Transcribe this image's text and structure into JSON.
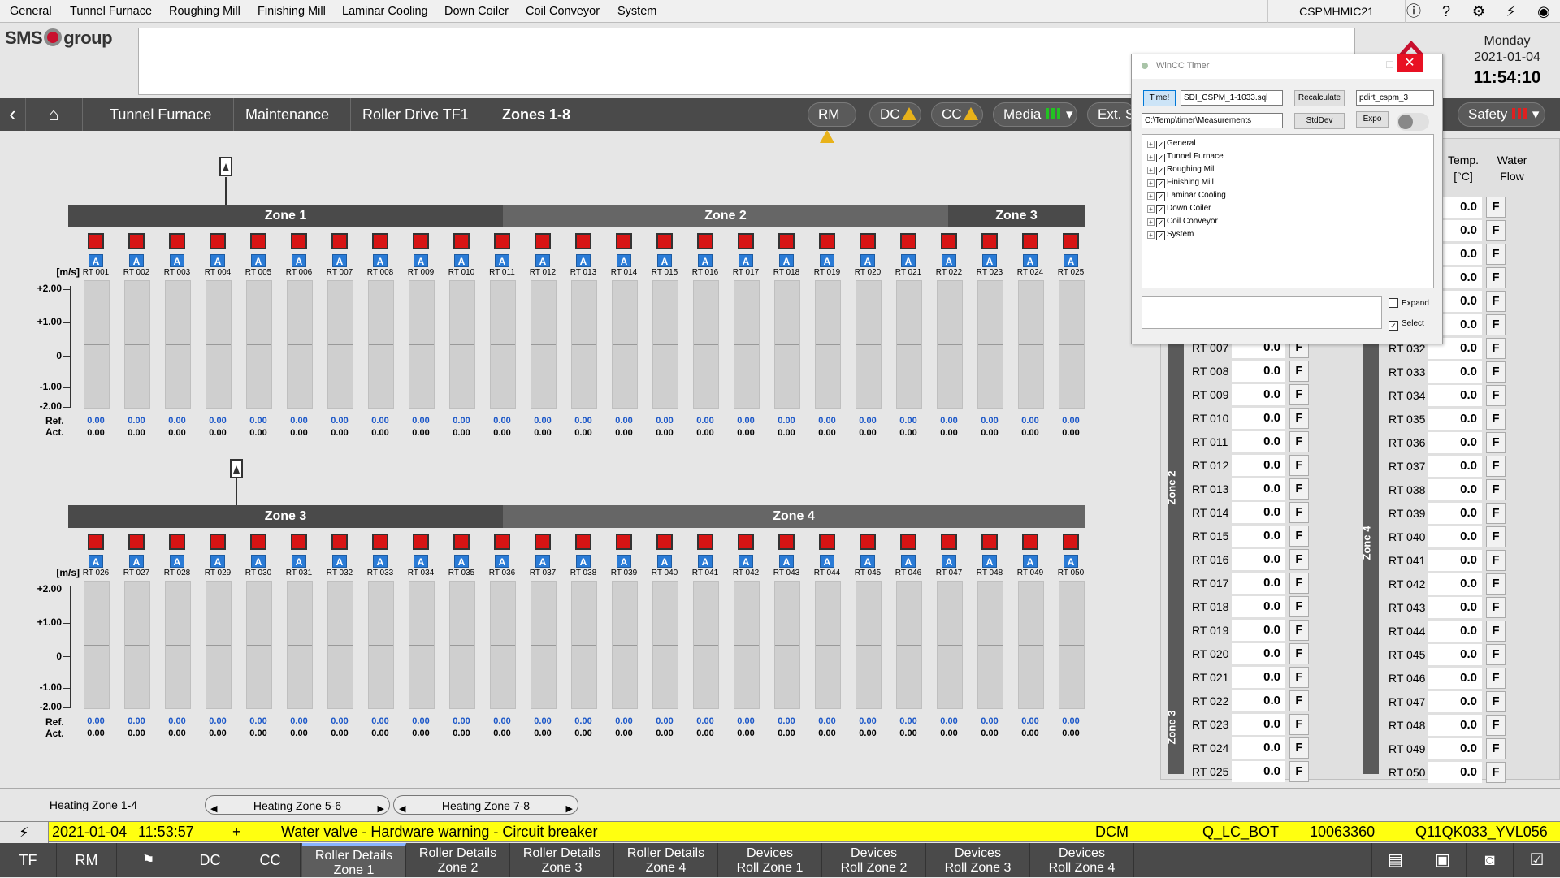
{
  "top_menu": {
    "items": [
      "General",
      "Tunnel Furnace",
      "Roughing Mill",
      "Finishing Mill",
      "Laminar Cooling",
      "Down Coiler",
      "Coil Conveyor",
      "System"
    ],
    "hostname": "CSPMHMIC21",
    "icons": [
      "info-icon",
      "help-icon",
      "settings-icon",
      "power-icon",
      "view-icon"
    ]
  },
  "brand": {
    "logo_text": "SMS",
    "logo_text2": "group"
  },
  "datetime": {
    "day": "Monday",
    "date": "2021-01-04",
    "time": "11:54:10"
  },
  "nav": {
    "crumbs": [
      "Tunnel Furnace",
      "Maintenance",
      "Roller Drive TF1",
      "Zones 1-8"
    ],
    "pills": [
      "RM",
      "DC",
      "CC",
      "Media",
      "Ext. S"
    ],
    "safety": "Safety"
  },
  "panel_top": {
    "zones": [
      "Zone 1",
      "Zone 2",
      "Zone 3"
    ],
    "unit": "[m/s]",
    "yticks": [
      "+2.00",
      "+1.00",
      "0",
      "-1.00",
      "-2.00"
    ],
    "ref_label": "Ref.",
    "act_label": "Act.",
    "rollers": [
      "RT 001",
      "RT 002",
      "RT 003",
      "RT 004",
      "RT 005",
      "RT 006",
      "RT 007",
      "RT 008",
      "RT 009",
      "RT 010",
      "RT 011",
      "RT 012",
      "RT 013",
      "RT 014",
      "RT 015",
      "RT 016",
      "RT 017",
      "RT 018",
      "RT 019",
      "RT 020",
      "RT 021",
      "RT 022",
      "RT 023",
      "RT 024",
      "RT 025"
    ],
    "ref": [
      "0.00",
      "0.00",
      "0.00",
      "0.00",
      "0.00",
      "0.00",
      "0.00",
      "0.00",
      "0.00",
      "0.00",
      "0.00",
      "0.00",
      "0.00",
      "0.00",
      "0.00",
      "0.00",
      "0.00",
      "0.00",
      "0.00",
      "0.00",
      "0.00",
      "0.00",
      "0.00",
      "0.00",
      "0.00"
    ],
    "act": [
      "0.00",
      "0.00",
      "0.00",
      "0.00",
      "0.00",
      "0.00",
      "0.00",
      "0.00",
      "0.00",
      "0.00",
      "0.00",
      "0.00",
      "0.00",
      "0.00",
      "0.00",
      "0.00",
      "0.00",
      "0.00",
      "0.00",
      "0.00",
      "0.00",
      "0.00",
      "0.00",
      "0.00",
      "0.00"
    ]
  },
  "panel_bottom": {
    "zones": [
      "Zone 3",
      "Zone 4"
    ],
    "unit": "[m/s]",
    "yticks": [
      "+2.00",
      "+1.00",
      "0",
      "-1.00",
      "-2.00"
    ],
    "ref_label": "Ref.",
    "act_label": "Act.",
    "rollers": [
      "RT 026",
      "RT 027",
      "RT 028",
      "RT 029",
      "RT 030",
      "RT 031",
      "RT 032",
      "RT 033",
      "RT 034",
      "RT 035",
      "RT 036",
      "RT 037",
      "RT 038",
      "RT 039",
      "RT 040",
      "RT 041",
      "RT 042",
      "RT 043",
      "RT 044",
      "RT 045",
      "RT 046",
      "RT 047",
      "RT 048",
      "RT 049",
      "RT 050"
    ],
    "ref": [
      "0.00",
      "0.00",
      "0.00",
      "0.00",
      "0.00",
      "0.00",
      "0.00",
      "0.00",
      "0.00",
      "0.00",
      "0.00",
      "0.00",
      "0.00",
      "0.00",
      "0.00",
      "0.00",
      "0.00",
      "0.00",
      "0.00",
      "0.00",
      "0.00",
      "0.00",
      "0.00",
      "0.00",
      "0.00"
    ],
    "act": [
      "0.00",
      "0.00",
      "0.00",
      "0.00",
      "0.00",
      "0.00",
      "0.00",
      "0.00",
      "0.00",
      "0.00",
      "0.00",
      "0.00",
      "0.00",
      "0.00",
      "0.00",
      "0.00",
      "0.00",
      "0.00",
      "0.00",
      "0.00",
      "0.00",
      "0.00",
      "0.00",
      "0.00",
      "0.00"
    ],
    "a_label": "A"
  },
  "right_panel": {
    "header_temp": "Temp.",
    "header_temp_unit": "[°C]",
    "header_water": "Water",
    "header_flow": "Flow",
    "zone_labels": [
      "Zone 2",
      "Zone 3",
      "Zone 4"
    ],
    "left_rows": [
      {
        "name": "RT 007",
        "value": "0.0",
        "flag": "F"
      },
      {
        "name": "RT 008",
        "value": "0.0",
        "flag": "F"
      },
      {
        "name": "RT 009",
        "value": "0.0",
        "flag": "F"
      },
      {
        "name": "RT 010",
        "value": "0.0",
        "flag": "F"
      },
      {
        "name": "RT 011",
        "value": "0.0",
        "flag": "F"
      },
      {
        "name": "RT 012",
        "value": "0.0",
        "flag": "F"
      },
      {
        "name": "RT 013",
        "value": "0.0",
        "flag": "F"
      },
      {
        "name": "RT 014",
        "value": "0.0",
        "flag": "F"
      },
      {
        "name": "RT 015",
        "value": "0.0",
        "flag": "F"
      },
      {
        "name": "RT 016",
        "value": "0.0",
        "flag": "F"
      },
      {
        "name": "RT 017",
        "value": "0.0",
        "flag": "F"
      },
      {
        "name": "RT 018",
        "value": "0.0",
        "flag": "F"
      },
      {
        "name": "RT 019",
        "value": "0.0",
        "flag": "F"
      },
      {
        "name": "RT 020",
        "value": "0.0",
        "flag": "F"
      },
      {
        "name": "RT 021",
        "value": "0.0",
        "flag": "F"
      },
      {
        "name": "RT 022",
        "value": "0.0",
        "flag": "F"
      },
      {
        "name": "RT 023",
        "value": "0.0",
        "flag": "F"
      },
      {
        "name": "RT 024",
        "value": "0.0",
        "flag": "F"
      },
      {
        "name": "RT 025",
        "value": "0.0",
        "flag": "F"
      }
    ],
    "right_rows": [
      {
        "name": "",
        "value": "0.0",
        "flag": "F"
      },
      {
        "name": "",
        "value": "0.0",
        "flag": "F"
      },
      {
        "name": "",
        "value": "0.0",
        "flag": "F"
      },
      {
        "name": "",
        "value": "0.0",
        "flag": "F"
      },
      {
        "name": "",
        "value": "0.0",
        "flag": "F"
      },
      {
        "name": "",
        "value": "0.0",
        "flag": "F"
      },
      {
        "name": "RT 032",
        "value": "0.0",
        "flag": "F"
      },
      {
        "name": "RT 033",
        "value": "0.0",
        "flag": "F"
      },
      {
        "name": "RT 034",
        "value": "0.0",
        "flag": "F"
      },
      {
        "name": "RT 035",
        "value": "0.0",
        "flag": "F"
      },
      {
        "name": "RT 036",
        "value": "0.0",
        "flag": "F"
      },
      {
        "name": "RT 037",
        "value": "0.0",
        "flag": "F"
      },
      {
        "name": "RT 038",
        "value": "0.0",
        "flag": "F"
      },
      {
        "name": "RT 039",
        "value": "0.0",
        "flag": "F"
      },
      {
        "name": "RT 040",
        "value": "0.0",
        "flag": "F"
      },
      {
        "name": "RT 041",
        "value": "0.0",
        "flag": "F"
      },
      {
        "name": "RT 042",
        "value": "0.0",
        "flag": "F"
      },
      {
        "name": "RT 043",
        "value": "0.0",
        "flag": "F"
      },
      {
        "name": "RT 044",
        "value": "0.0",
        "flag": "F"
      },
      {
        "name": "RT 045",
        "value": "0.0",
        "flag": "F"
      },
      {
        "name": "RT 046",
        "value": "0.0",
        "flag": "F"
      },
      {
        "name": "RT 047",
        "value": "0.0",
        "flag": "F"
      },
      {
        "name": "RT 048",
        "value": "0.0",
        "flag": "F"
      },
      {
        "name": "RT 049",
        "value": "0.0",
        "flag": "F"
      },
      {
        "name": "RT 050",
        "value": "0.0",
        "flag": "F"
      }
    ]
  },
  "wincc": {
    "title": "WinCC Timer",
    "time_btn": "Time!",
    "file_input": "SDI_CSPM_1-1033.sql",
    "recalc_btn": "Recalculate",
    "db_input": "pdirt_cspm_3",
    "path_input": "C:\\Temp\\timer\\Measurements",
    "stddev_btn": "StdDev",
    "expo_btn": "Expo",
    "tree": [
      "General",
      "Tunnel Furnace",
      "Roughing Mill",
      "Finishing Mill",
      "Laminar Cooling",
      "Down Coiler",
      "Coil Conveyor",
      "System"
    ],
    "expand_label": "Expand",
    "select_label": "Select"
  },
  "heating": {
    "items": [
      "Heating Zone 1-4",
      "Heating Zone 5-6",
      "Heating Zone 7-8"
    ]
  },
  "alarm": {
    "date": "2021-01-04",
    "time": "11:53:57",
    "sign": "+",
    "message": "Water valve - Hardware warning - Circuit breaker",
    "source": "DCM",
    "location": "Q_LC_BOT",
    "code": "10063360",
    "tag": "Q11QK033_YVL056"
  },
  "bottom_bar": {
    "buttons": [
      "TF",
      "RM",
      "",
      "DC",
      "CC"
    ],
    "tabs": [
      {
        "l1": "Roller Details",
        "l2": "Zone 1"
      },
      {
        "l1": "Roller Details",
        "l2": "Zone 2"
      },
      {
        "l1": "Roller Details",
        "l2": "Zone 3"
      },
      {
        "l1": "Roller Details",
        "l2": "Zone 4"
      },
      {
        "l1": "Devices",
        "l2": "Roll Zone 1"
      },
      {
        "l1": "Devices",
        "l2": "Roll Zone 2"
      },
      {
        "l1": "Devices",
        "l2": "Roll Zone 3"
      },
      {
        "l1": "Devices",
        "l2": "Roll Zone 4"
      }
    ]
  },
  "colors": {
    "accent_red": "#d71414",
    "accent_blue": "#2a7bd6",
    "alarm_yellow": "#ffff10",
    "bar_dark": "#4a4a4a"
  }
}
